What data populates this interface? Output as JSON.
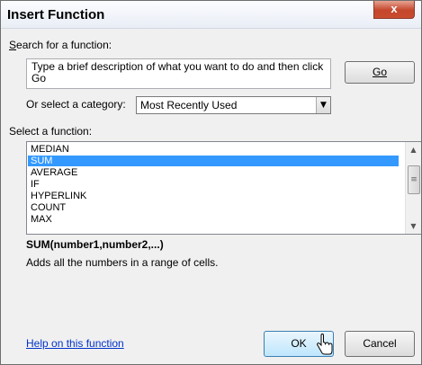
{
  "dialog": {
    "title": "Insert Function",
    "title_buttons": {
      "help": "?",
      "close": "x"
    }
  },
  "search": {
    "label": "Search for a function:",
    "value": "Type a brief description of what you want to do and then click Go",
    "go_label": "Go"
  },
  "category": {
    "label": "Or select a category:",
    "selected": "Most Recently Used"
  },
  "functions": {
    "label": "Select a function:",
    "items": [
      "MEDIAN",
      "SUM",
      "AVERAGE",
      "IF",
      "HYPERLINK",
      "COUNT",
      "MAX"
    ],
    "selected": "SUM"
  },
  "description": {
    "signature": "SUM(number1,number2,...)",
    "text": "Adds all the numbers in a range of cells."
  },
  "footer": {
    "help_link": "Help on this function",
    "ok_label": "OK",
    "cancel_label": "Cancel"
  }
}
